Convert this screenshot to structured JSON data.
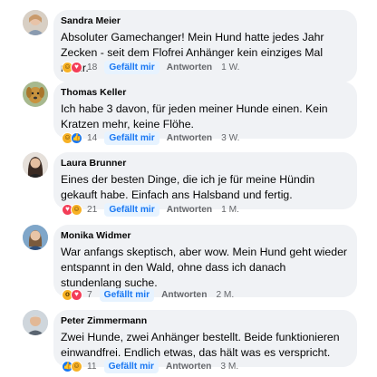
{
  "comments": [
    {
      "author": "Sandra Meier",
      "text": "Absoluter Gamechanger! Mein Hund hatte jedes Jahr Zecken - seit dem Flofrei Anhänger kein einziges Mal mehr.",
      "reactions": [
        "haha",
        "heart"
      ],
      "count": "18",
      "like_label": "Gefällt mir",
      "answer_label": "Antworten",
      "time": "1 W."
    },
    {
      "author": "Thomas Keller",
      "text": "Ich habe 3 davon, für jeden meiner Hunde einen. Kein Kratzen mehr, keine Flöhe.",
      "reactions": [
        "haha",
        "like"
      ],
      "count": "14",
      "like_label": "Gefällt mir",
      "answer_label": "Antworten",
      "time": "3 W."
    },
    {
      "author": "Laura Brunner",
      "text": "Eines der besten Dinge, die ich je für meine Hündin gekauft habe. Einfach ans Halsband und fertig.",
      "reactions": [
        "heart",
        "care"
      ],
      "count": "21",
      "like_label": "Gefällt mir",
      "answer_label": "Antworten",
      "time": "1 M."
    },
    {
      "author": "Monika Widmer",
      "text": "War anfangs skeptisch, aber wow. Mein Hund geht wieder entspannt in den Wald, ohne dass ich danach stundenlang suche.",
      "reactions": [
        "wow",
        "heart"
      ],
      "count": "7",
      "like_label": "Gefällt mir",
      "answer_label": "Antworten",
      "time": "2 M."
    },
    {
      "author": "Peter Zimmermann",
      "text": "Zwei Hunde, zwei Anhänger bestellt. Beide funktionieren einwandfrei. Endlich etwas, das hält was es verspricht.",
      "reactions": [
        "like",
        "haha"
      ],
      "count": "11",
      "like_label": "Gefällt mir",
      "answer_label": "Antworten",
      "time": "3 M."
    }
  ],
  "colors": {
    "bubble": "#f0f2f5",
    "like_accent": "#1877f2",
    "meta_text": "#65676b"
  }
}
